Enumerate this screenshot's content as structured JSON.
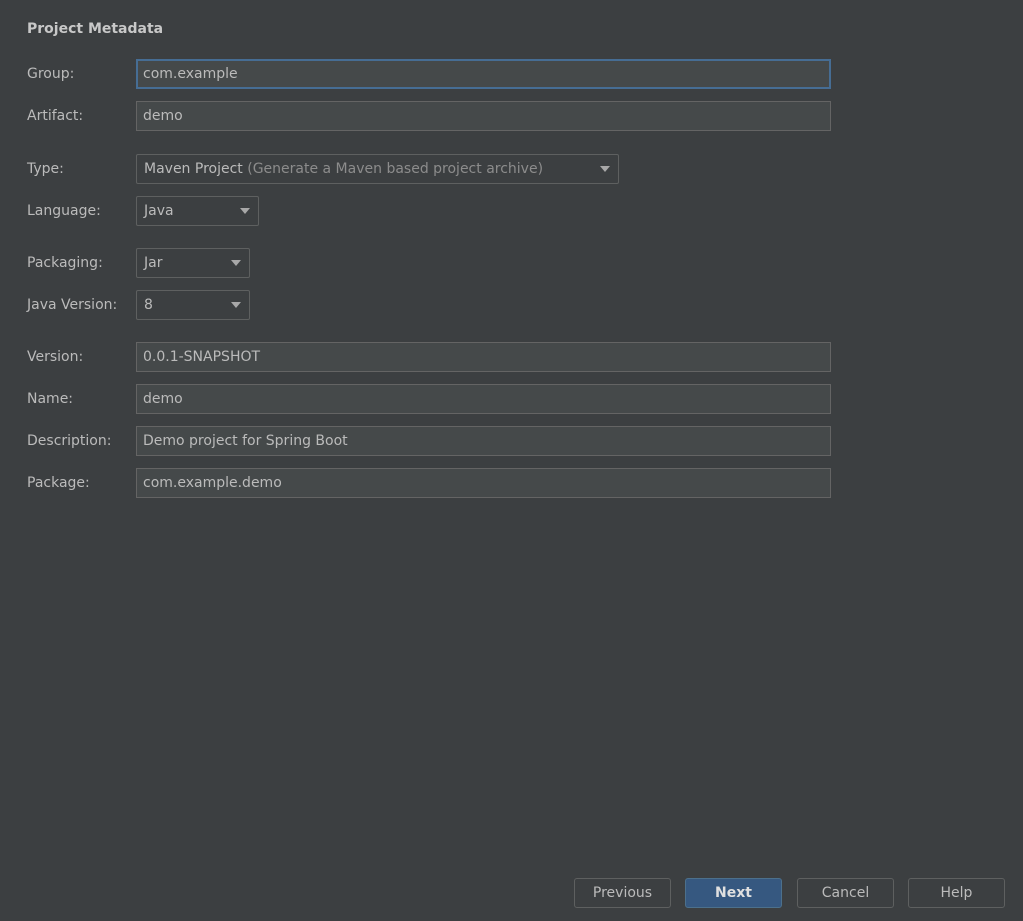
{
  "section_title": "Project Metadata",
  "fields": {
    "group": {
      "label": "Group:",
      "value": "com.example"
    },
    "artifact": {
      "label": "Artifact:",
      "value": "demo"
    },
    "type": {
      "label": "Type:",
      "value": "Maven Project",
      "hint": "(Generate a Maven based project archive)"
    },
    "language": {
      "label": "Language:",
      "value": "Java"
    },
    "packaging": {
      "label": "Packaging:",
      "value": "Jar"
    },
    "java_version": {
      "label": "Java Version:",
      "value": "8"
    },
    "version": {
      "label": "Version:",
      "value": "0.0.1-SNAPSHOT"
    },
    "name": {
      "label": "Name:",
      "value": "demo"
    },
    "description": {
      "label": "Description:",
      "value": "Demo project for Spring Boot"
    },
    "package": {
      "label": "Package:",
      "value": "com.example.demo"
    }
  },
  "buttons": {
    "previous": "Previous",
    "next": "Next",
    "cancel": "Cancel",
    "help": "Help"
  },
  "colors": {
    "background": "#3c3f41",
    "field_bg": "#45494a",
    "focus_border": "#466d94",
    "primary_button": "#365880"
  }
}
